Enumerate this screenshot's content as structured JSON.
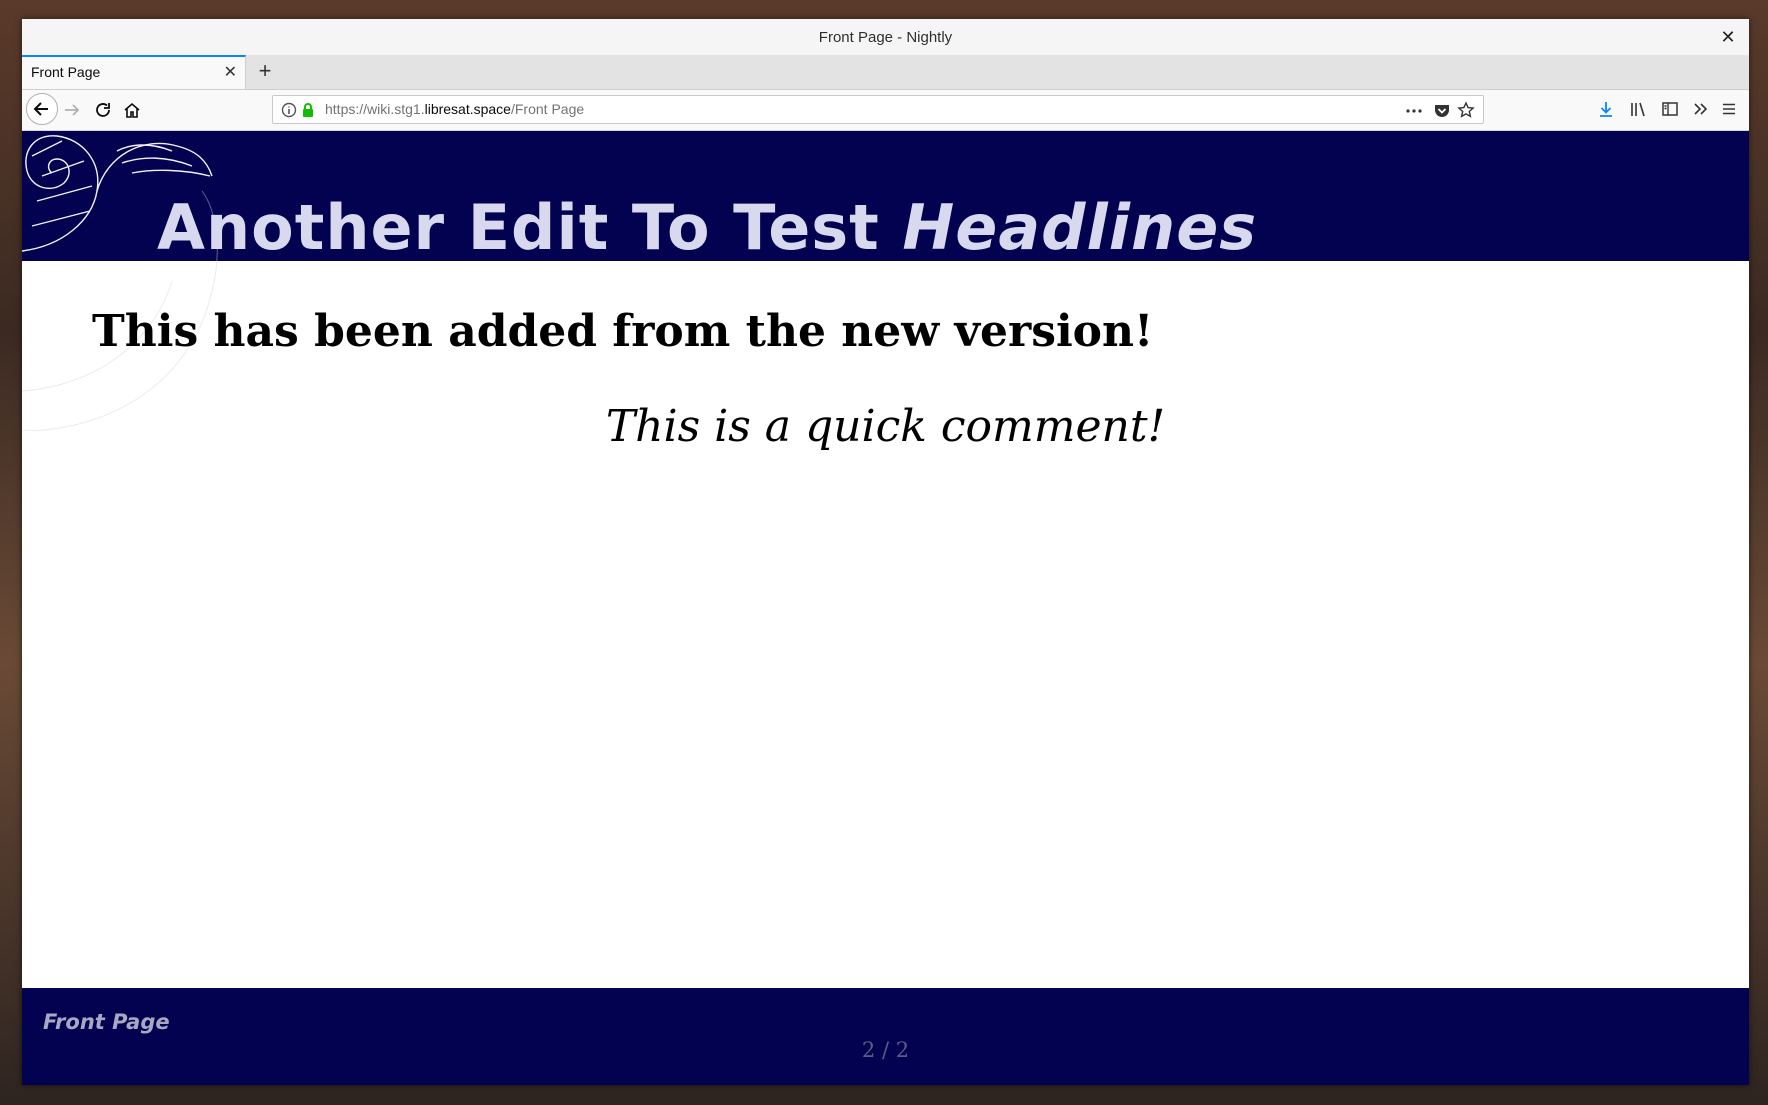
{
  "window": {
    "title": "Front Page - Nightly"
  },
  "tabs": [
    {
      "label": "Front Page"
    }
  ],
  "urlbar": {
    "prefix": "https://wiki.stg1.",
    "domain": "libresat.space",
    "path": "/Front Page"
  },
  "toolbar_icons": [
    "back-icon",
    "forward-icon",
    "reload-icon",
    "home-icon",
    "info-icon",
    "lock-icon",
    "more-icon",
    "pocket-icon",
    "star-icon",
    "download-icon",
    "library-icon",
    "sidebar-icon",
    "overflow-icon",
    "menu-icon"
  ],
  "page": {
    "title_main": "Another Edit To Test ",
    "title_italic": "Headlines",
    "headline": "This has been added from the new version!",
    "comment": "This is a quick comment!",
    "footer_title": "Front Page",
    "page_count": "2 / 2"
  },
  "colors": {
    "header_bg": "#020250",
    "title_text": "#d8d8ee",
    "accent_tab": "#0a84ff",
    "download_icon": "#0a84ff",
    "lock_icon": "#12bc00"
  }
}
